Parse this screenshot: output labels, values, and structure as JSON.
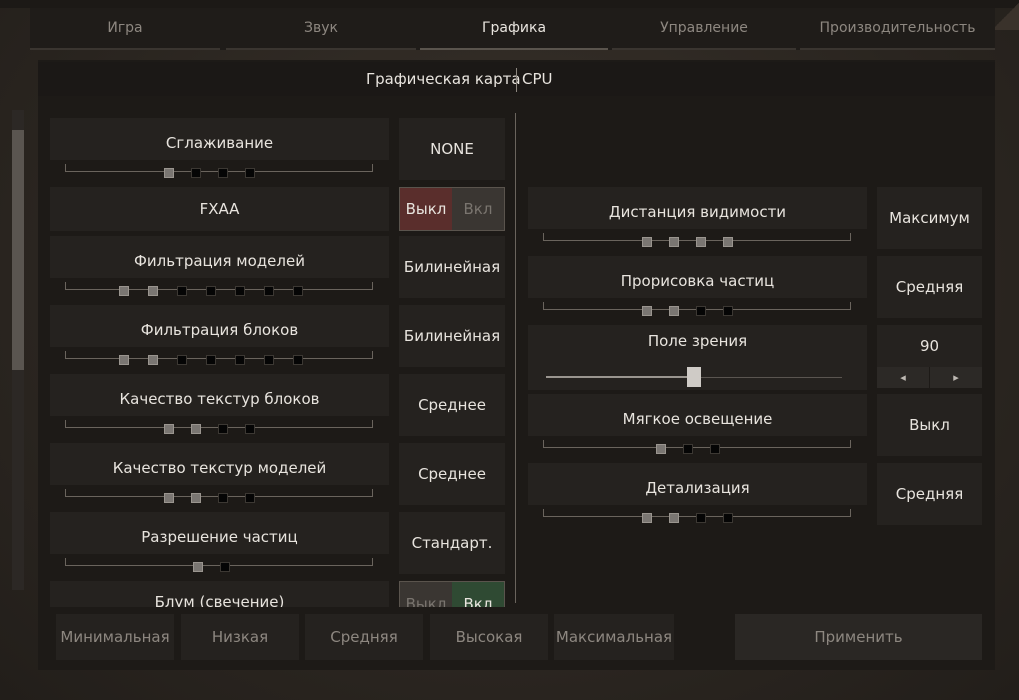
{
  "tabs": [
    "Игра",
    "Звук",
    "Графика",
    "Управление",
    "Производительность"
  ],
  "active_tab": "Графика",
  "subtabs": [
    "Графическая карта",
    "CPU"
  ],
  "left": {
    "antialiasing": {
      "label": "Сглаживание",
      "value": "NONE",
      "level": 1,
      "steps": 4
    },
    "fxaa": {
      "label": "FXAA",
      "off": "Выкл",
      "on": "Вкл",
      "state": "off"
    },
    "model_filter": {
      "label": "Фильтрация моделей",
      "value": "Билинейная",
      "level": 2,
      "steps": 7
    },
    "block_filter": {
      "label": "Фильтрация блоков",
      "value": "Билинейная",
      "level": 2,
      "steps": 7
    },
    "block_textures": {
      "label": "Качество текстур блоков",
      "value": "Среднее",
      "level": 2,
      "steps": 4
    },
    "model_textures": {
      "label": "Качество текстур моделей",
      "value": "Среднее",
      "level": 2,
      "steps": 4
    },
    "particle_res": {
      "label": "Разрешение частиц",
      "value": "Стандарт.",
      "level": 1,
      "steps": 2
    },
    "bloom": {
      "label": "Блум (свечение)",
      "off": "Выкл",
      "on": "Вкл",
      "state": "on"
    }
  },
  "right": {
    "view_distance": {
      "label": "Дистанция видимости",
      "value": "Максимум",
      "level": 4,
      "steps": 4
    },
    "particles": {
      "label": "Прорисовка частиц",
      "value": "Средняя",
      "level": 2,
      "steps": 4
    },
    "fov": {
      "label": "Поле зрения",
      "value": "90",
      "position": 0.5,
      "left_arrow": "◂",
      "right_arrow": "▸"
    },
    "soft_light": {
      "label": "Мягкое освещение",
      "value": "Выкл",
      "level": 1,
      "steps": 3
    },
    "detail": {
      "label": "Детализация",
      "value": "Средняя",
      "level": 2,
      "steps": 4
    }
  },
  "presets": [
    "Минимальная",
    "Низкая",
    "Средняя",
    "Высокая",
    "Максимальная"
  ],
  "apply_label": "Применить"
}
